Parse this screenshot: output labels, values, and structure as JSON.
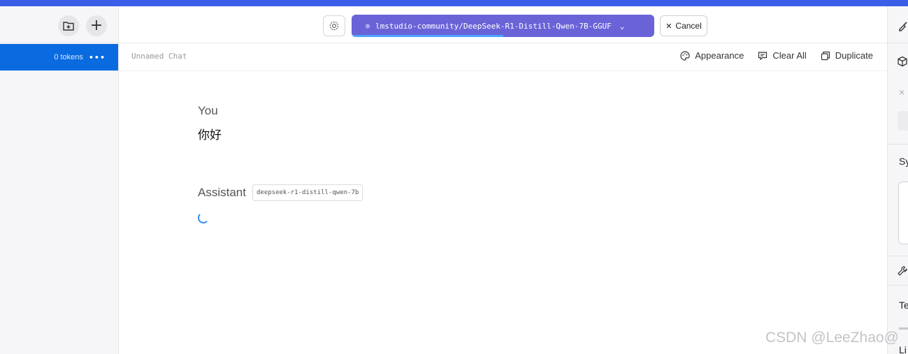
{
  "sidebar": {
    "chat_item": {
      "tokens": "0 tokens",
      "more": "•••"
    }
  },
  "header": {
    "model_name": "lmstudio-community/DeepSeek-R1-Distill-Qwen-7B-GGUF",
    "cancel_label": "Cancel",
    "load_progress": 0.5
  },
  "subheader": {
    "chat_title": "Unnamed Chat",
    "appearance_label": "Appearance",
    "clear_all_label": "Clear All",
    "duplicate_label": "Duplicate"
  },
  "messages": {
    "user_role": "You",
    "user_text": "你好",
    "assistant_role": "Assistant",
    "assistant_model": "deepseek-r1-distill-qwen-7b"
  },
  "right_panel": {
    "close_glyph": "×",
    "system_prompt_label_fragment": "Sy",
    "temperature_label_fragment": "Te",
    "limit_label_fragment": "Li"
  },
  "watermark": "CSDN @LeeZhao@",
  "colors": {
    "accent": "#3b5ee9",
    "selected_chat": "#0a6ae0",
    "model_pill": "#6a63d8"
  }
}
